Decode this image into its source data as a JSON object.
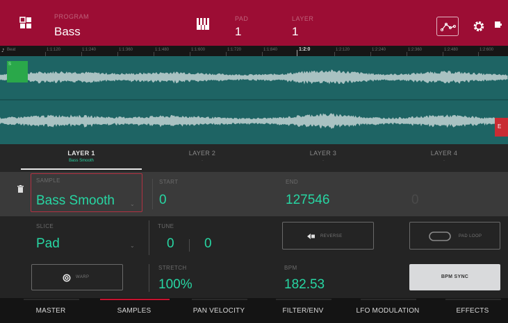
{
  "header": {
    "program_label": "PROGRAM",
    "program_name": "Bass",
    "pad_label": "PAD",
    "pad_value": "1",
    "tab2_label": "LAYER",
    "tab2_value": "1",
    "bg_color": "#9c0d34"
  },
  "ruler": {
    "labels": [
      "1:1:120",
      "1:1:240",
      "1:1:360",
      "1:1:480",
      "1:1:600",
      "1:1:720",
      "1:1:840",
      "1:2:0",
      "1:2:120",
      "1:2:240",
      "1:2:360",
      "1:2:480",
      "1:2:600"
    ],
    "highlight": "1:2:0"
  },
  "wave": {
    "bg_color": "#1e6464",
    "start_marker": "S",
    "end_marker": "E"
  },
  "layers": [
    {
      "name": "LAYER 1",
      "sample": "Bass Smooth",
      "active": true
    },
    {
      "name": "LAYER 2",
      "sample": "-",
      "active": false
    },
    {
      "name": "LAYER 3",
      "sample": "-",
      "active": false
    },
    {
      "name": "LAYER 4",
      "sample": "-",
      "active": false
    }
  ],
  "params": {
    "sample_label": "SAMPLE",
    "sample_value": "Bass Smooth",
    "start_label": "START",
    "start_value": "0",
    "end_label": "END",
    "end_value": "127546",
    "loop_value": "0",
    "slice_label": "SLICE",
    "slice_value": "Pad",
    "tune_label": "TUNE",
    "tune_coarse": "0",
    "tune_fine": "0",
    "reverse_label": "REVERSE",
    "padloop_label": "PAD LOOP",
    "warp_label": "WARP",
    "stretch_label": "STRETCH",
    "stretch_value": "100%",
    "bpm_label": "BPM",
    "bpm_value": "182.53",
    "bpm_sync_label": "BPM SYNC",
    "value_color": "#27d6a3"
  },
  "tabs": [
    {
      "label": "MASTER",
      "active": false
    },
    {
      "label": "SAMPLES",
      "active": true
    },
    {
      "label": "PAN VELOCITY",
      "active": false
    },
    {
      "label": "FILTER/ENV",
      "active": false
    },
    {
      "label": "LFO MODULATION",
      "active": false
    },
    {
      "label": "EFFECTS",
      "active": false
    }
  ]
}
